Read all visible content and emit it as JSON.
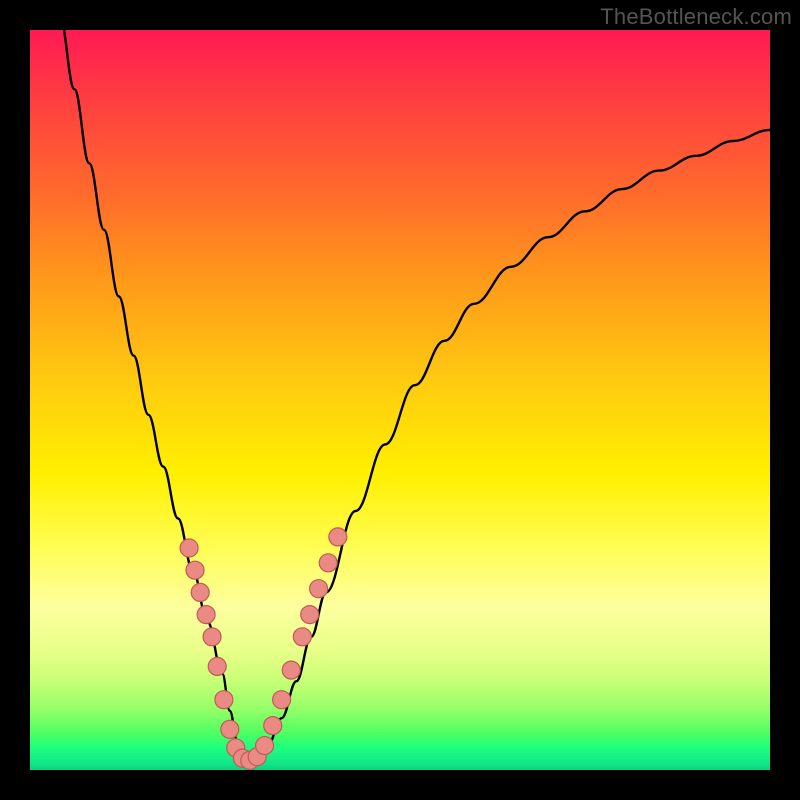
{
  "watermark": "TheBottleneck.com",
  "chart_data": {
    "type": "line",
    "title": "",
    "xlabel": "",
    "ylabel": "",
    "xlim": [
      0,
      100
    ],
    "ylim": [
      0,
      100
    ],
    "grid": false,
    "series": [
      {
        "name": "curve",
        "x": [
          4,
          6,
          8,
          10,
          12,
          14,
          16,
          18,
          20,
          22,
          24,
          26,
          27,
          28,
          29,
          30,
          32,
          34,
          36,
          38,
          40,
          44,
          48,
          52,
          56,
          60,
          65,
          70,
          75,
          80,
          85,
          90,
          95,
          100
        ],
        "values": [
          102,
          92,
          82,
          73,
          64,
          56,
          48,
          41,
          34,
          27,
          20,
          13,
          8,
          4,
          1.5,
          1.3,
          3,
          7,
          12,
          18,
          24,
          35,
          44,
          52,
          58,
          63,
          68,
          72,
          75.5,
          78.5,
          81,
          83,
          85,
          86.5
        ]
      }
    ],
    "markers": [
      {
        "x": 21.5,
        "y": 30
      },
      {
        "x": 22.3,
        "y": 27
      },
      {
        "x": 23.0,
        "y": 24
      },
      {
        "x": 23.8,
        "y": 21
      },
      {
        "x": 24.6,
        "y": 18
      },
      {
        "x": 25.3,
        "y": 14
      },
      {
        "x": 26.2,
        "y": 9.5
      },
      {
        "x": 27.0,
        "y": 5.5
      },
      {
        "x": 27.8,
        "y": 3.0
      },
      {
        "x": 28.7,
        "y": 1.6
      },
      {
        "x": 29.7,
        "y": 1.3
      },
      {
        "x": 30.7,
        "y": 1.8
      },
      {
        "x": 31.7,
        "y": 3.3
      },
      {
        "x": 32.8,
        "y": 6.0
      },
      {
        "x": 34.0,
        "y": 9.5
      },
      {
        "x": 35.3,
        "y": 13.5
      },
      {
        "x": 36.8,
        "y": 18.0
      },
      {
        "x": 37.8,
        "y": 21.0
      },
      {
        "x": 39.0,
        "y": 24.5
      },
      {
        "x": 40.3,
        "y": 28.0
      },
      {
        "x": 41.6,
        "y": 31.5
      }
    ],
    "marker_style": {
      "fill": "#e98a85",
      "stroke": "#c25a52",
      "r": 9
    }
  }
}
